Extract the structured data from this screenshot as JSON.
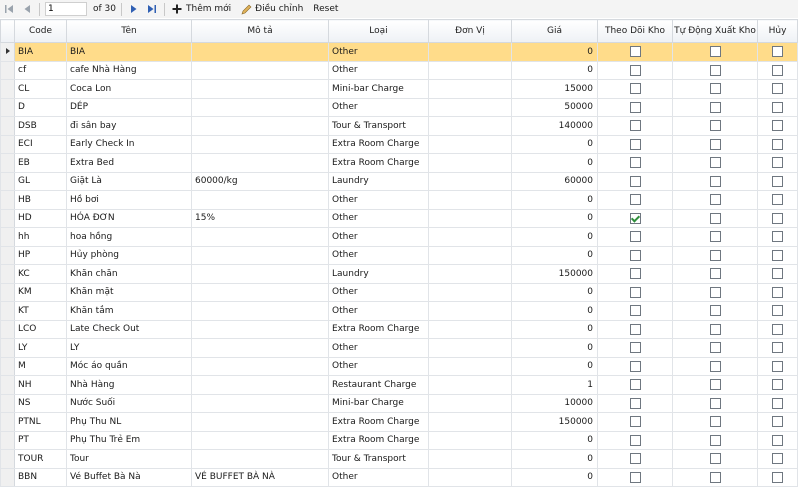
{
  "toolbar": {
    "position": "1",
    "total_label": "of 30",
    "add_label": "Thêm mới",
    "edit_label": "Điều chỉnh",
    "reset_label": "Reset"
  },
  "columns": [
    "Code",
    "Tên",
    "Mô tả",
    "Loại",
    "Đơn Vị",
    "Giá",
    "Theo Dõi Kho",
    "Tự Động Xuất Kho",
    "Hủy"
  ],
  "rows": [
    {
      "code": "BIA",
      "name": "BIA",
      "desc": "",
      "type": "Other",
      "unit": "",
      "price": "0",
      "track": false,
      "auto": false,
      "cancel": false
    },
    {
      "code": "cf",
      "name": "cafe Nhà Hàng",
      "desc": "",
      "type": "Other",
      "unit": "",
      "price": "0",
      "track": false,
      "auto": false,
      "cancel": false
    },
    {
      "code": "CL",
      "name": "Coca Lon",
      "desc": "",
      "type": "Mini-bar Charge",
      "unit": "",
      "price": "15000",
      "track": false,
      "auto": false,
      "cancel": false
    },
    {
      "code": "D",
      "name": "DÉP",
      "desc": "",
      "type": "Other",
      "unit": "",
      "price": "50000",
      "track": false,
      "auto": false,
      "cancel": false
    },
    {
      "code": "DSB",
      "name": "đi sân bay",
      "desc": "",
      "type": "Tour & Transport",
      "unit": "",
      "price": "140000",
      "track": false,
      "auto": false,
      "cancel": false
    },
    {
      "code": "ECI",
      "name": "Early Check In",
      "desc": "",
      "type": "Extra Room Charge",
      "unit": "",
      "price": "0",
      "track": false,
      "auto": false,
      "cancel": false
    },
    {
      "code": "EB",
      "name": "Extra Bed",
      "desc": "",
      "type": "Extra Room Charge",
      "unit": "",
      "price": "0",
      "track": false,
      "auto": false,
      "cancel": false
    },
    {
      "code": "GL",
      "name": "Giặt Là",
      "desc": "60000/kg",
      "type": "Laundry",
      "unit": "",
      "price": "60000",
      "track": false,
      "auto": false,
      "cancel": false
    },
    {
      "code": "HB",
      "name": "Hồ bơi",
      "desc": "",
      "type": "Other",
      "unit": "",
      "price": "0",
      "track": false,
      "auto": false,
      "cancel": false
    },
    {
      "code": "HD",
      "name": "HÓA ĐƠN",
      "desc": "15%",
      "type": "Other",
      "unit": "",
      "price": "0",
      "track": true,
      "auto": false,
      "cancel": false
    },
    {
      "code": "hh",
      "name": "hoa hồng",
      "desc": "",
      "type": "Other",
      "unit": "",
      "price": "0",
      "track": false,
      "auto": false,
      "cancel": false
    },
    {
      "code": "HP",
      "name": "Hủy phòng",
      "desc": "",
      "type": "Other",
      "unit": "",
      "price": "0",
      "track": false,
      "auto": false,
      "cancel": false
    },
    {
      "code": "KC",
      "name": "Khăn chăn",
      "desc": "",
      "type": "Laundry",
      "unit": "",
      "price": "150000",
      "track": false,
      "auto": false,
      "cancel": false
    },
    {
      "code": "KM",
      "name": "Khăn mặt",
      "desc": "",
      "type": "Other",
      "unit": "",
      "price": "0",
      "track": false,
      "auto": false,
      "cancel": false
    },
    {
      "code": "KT",
      "name": "Khăn tắm",
      "desc": "",
      "type": "Other",
      "unit": "",
      "price": "0",
      "track": false,
      "auto": false,
      "cancel": false
    },
    {
      "code": "LCO",
      "name": "Late Check Out",
      "desc": "",
      "type": "Extra Room Charge",
      "unit": "",
      "price": "0",
      "track": false,
      "auto": false,
      "cancel": false
    },
    {
      "code": "LY",
      "name": "LY",
      "desc": "",
      "type": "Other",
      "unit": "",
      "price": "0",
      "track": false,
      "auto": false,
      "cancel": false
    },
    {
      "code": "M",
      "name": "Móc áo quần",
      "desc": "",
      "type": "Other",
      "unit": "",
      "price": "0",
      "track": false,
      "auto": false,
      "cancel": false
    },
    {
      "code": "NH",
      "name": "Nhà Hàng",
      "desc": "",
      "type": "Restaurant Charge",
      "unit": "",
      "price": "1",
      "track": false,
      "auto": false,
      "cancel": false
    },
    {
      "code": "NS",
      "name": "Nước Suối",
      "desc": "",
      "type": "Mini-bar Charge",
      "unit": "",
      "price": "10000",
      "track": false,
      "auto": false,
      "cancel": false
    },
    {
      "code": "PTNL",
      "name": "Phụ Thu NL",
      "desc": "",
      "type": "Extra Room Charge",
      "unit": "",
      "price": "150000",
      "track": false,
      "auto": false,
      "cancel": false
    },
    {
      "code": "PT",
      "name": "Phụ Thu Trẻ Em",
      "desc": "",
      "type": "Extra Room Charge",
      "unit": "",
      "price": "0",
      "track": false,
      "auto": false,
      "cancel": false
    },
    {
      "code": "TOUR",
      "name": "Tour",
      "desc": "",
      "type": "Tour & Transport",
      "unit": "",
      "price": "0",
      "track": false,
      "auto": false,
      "cancel": false
    },
    {
      "code": "BBN",
      "name": "Vé Buffet Bà Nà",
      "desc": "VÉ BUFFET BÀ NÀ",
      "type": "Other",
      "unit": "",
      "price": "0",
      "track": false,
      "auto": false,
      "cancel": false
    }
  ],
  "selected_row": 0,
  "colors": {
    "selected_row": "#ffdc8a",
    "check": "#2f8f3b"
  },
  "icons": [
    "first-page-icon",
    "prev-page-icon",
    "next-page-icon",
    "last-page-icon",
    "add-icon",
    "edit-pencil-icon",
    "row-indicator-icon"
  ]
}
